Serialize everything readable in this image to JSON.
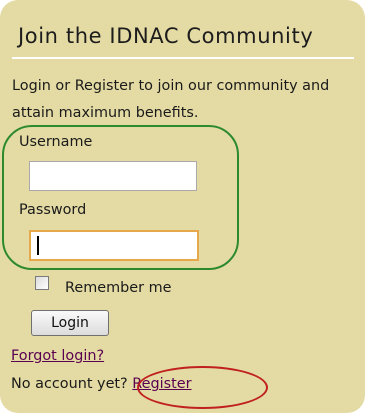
{
  "panel": {
    "title": "Join the IDNAC Community",
    "intro": "Login or Register to join our community and attain maximum benefits."
  },
  "form": {
    "username_label": "Username",
    "username_value": "",
    "password_label": "Password",
    "password_value": "",
    "remember_label": "Remember me",
    "remember_checked": false,
    "login_label": "Login"
  },
  "links": {
    "forgot": "Forgot login?",
    "no_account_prefix": "No account yet? ",
    "register": "Register"
  },
  "colors": {
    "panel_background": "#e4dba4",
    "link": "#5a0050",
    "focus_border": "#e5a84b",
    "annotation_green": "#2c8a2c",
    "annotation_red": "#c02020"
  }
}
